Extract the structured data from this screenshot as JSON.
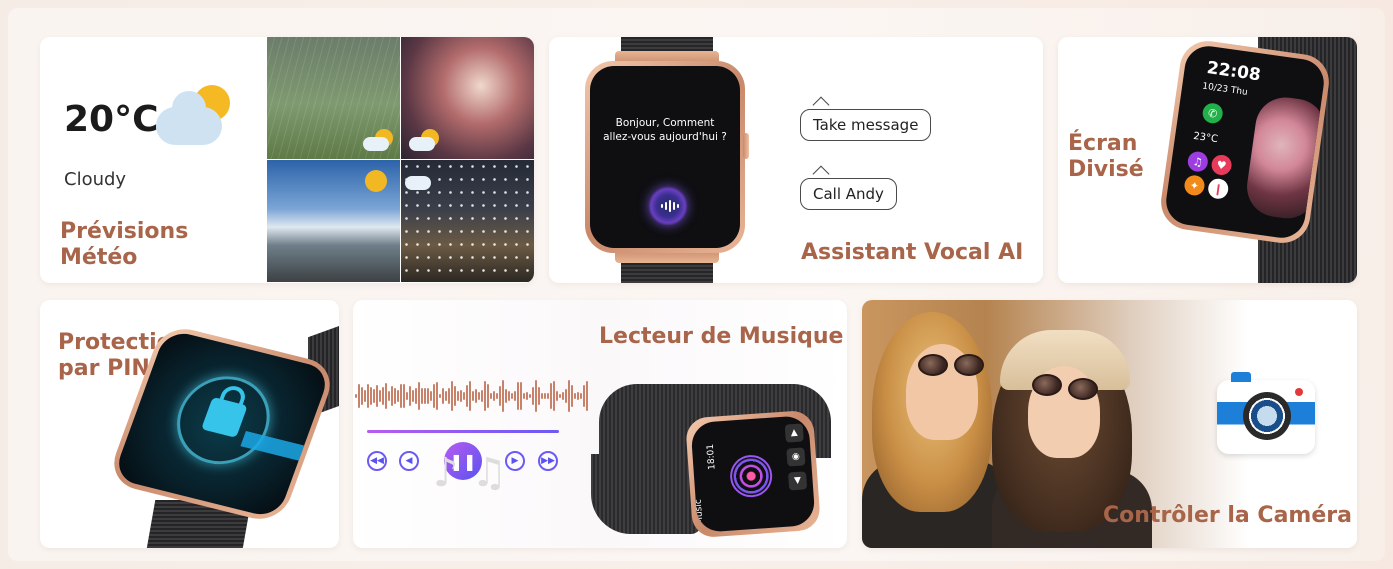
{
  "cards": {
    "weather": {
      "temperature": "20°C",
      "condition": "Cloudy",
      "title_line1": "Prévisions",
      "title_line2": "Météo"
    },
    "voice": {
      "screen_text_line1": "Bonjour, Comment",
      "screen_text_line2": "allez-vous aujourd'hui ?",
      "bubble1": "Take message",
      "bubble2": "Call Andy",
      "title": "Assistant Vocal AI"
    },
    "split": {
      "clock": "22:08",
      "date": "10/23 Thu",
      "temp": "23°C",
      "title_line1": "Écran",
      "title_line2": "Divisé"
    },
    "pin": {
      "title_line1": "Protection",
      "title_line2": "par PIN"
    },
    "music": {
      "title": "Lecteur de Musique",
      "watch_label": "Music",
      "watch_time": "18:01"
    },
    "camera": {
      "title": "Contrôler la Caméra"
    }
  },
  "colors": {
    "title": "#a8654a",
    "accent_purple": "#6a5af6",
    "camera_blue": "#1d7fd8"
  },
  "icons": [
    "sun-cloud-icon",
    "assistant-icon",
    "lock-icon",
    "play-pause-icon",
    "camera-icon"
  ]
}
